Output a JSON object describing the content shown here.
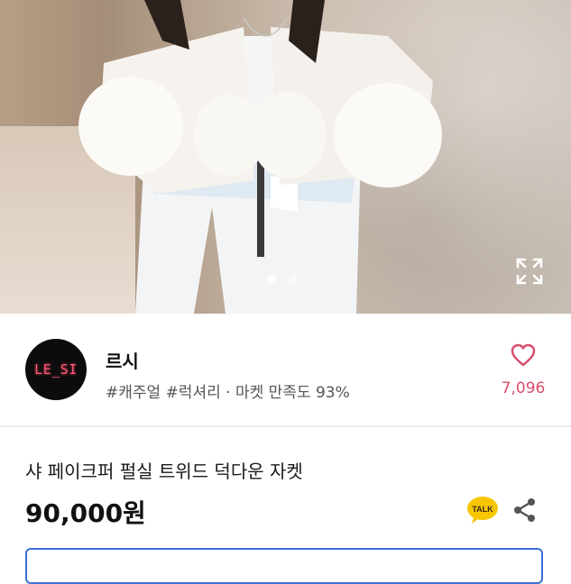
{
  "seller": {
    "avatar_logo": "LE_SI",
    "avatar_sub": "",
    "name": "르시",
    "tags": "#캐주얼 #럭셔리 · 마켓 만족도 93%",
    "like_count": "7,096"
  },
  "gallery": {
    "current_index": 1,
    "total": 2,
    "expand_icon": "expand-icon"
  },
  "product": {
    "title": "샤 페이크퍼 펄실 트위드 덕다운 자켓",
    "price": "90,000원"
  },
  "actions": {
    "talk_icon_label": "TALK",
    "share_icon": "share-icon"
  },
  "colors": {
    "like_pink": "#d94c6a",
    "talk_yellow": "#f7c600",
    "action_border": "#3b6fd8"
  }
}
